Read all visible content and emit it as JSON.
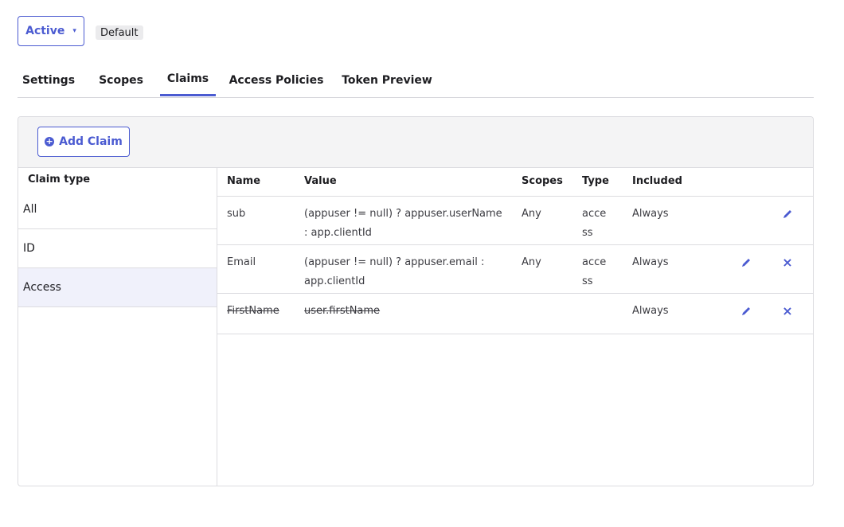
{
  "status": {
    "label": "Active",
    "caret": "▾"
  },
  "badge": {
    "label": "Default"
  },
  "tabs": [
    {
      "label": "Settings"
    },
    {
      "label": "Scopes"
    },
    {
      "label": "Claims"
    },
    {
      "label": "Access Policies"
    },
    {
      "label": "Token Preview"
    }
  ],
  "toolbar": {
    "add_claim_label": "Add Claim",
    "add_icon": "plus-circle-icon"
  },
  "claim_type": {
    "header": "Claim type",
    "items": [
      {
        "label": "All"
      },
      {
        "label": "ID"
      },
      {
        "label": "Access"
      }
    ],
    "selected": "Access"
  },
  "table": {
    "headers": {
      "name": "Name",
      "value": "Value",
      "scopes": "Scopes",
      "type": "Type",
      "included": "Included"
    },
    "rows": [
      {
        "name": "sub",
        "value_line1": "(appuser != null) ? appuser.userName",
        "value_line2": ": app.clientId",
        "scopes": "Any",
        "type_line1": "acce",
        "type_line2": "ss",
        "included": "Always"
      },
      {
        "name": "Email",
        "value_line1": "(appuser != null) ? appuser.email :",
        "value_line2": "app.clientId",
        "scopes": "Any",
        "type_line1": "acce",
        "type_line2": "ss",
        "included": "Always"
      },
      {
        "name": "FirstName",
        "value_line1": "user.firstName",
        "value_line2": "",
        "scopes": "",
        "type_line1": "",
        "type_line2": "",
        "included": "Always"
      }
    ]
  },
  "colors": {
    "accent": "#4b5bd1",
    "toolbar_bg": "#f4f4f5",
    "selected_bg": "#f0f1fb"
  },
  "icons": {
    "edit": "pencil-icon",
    "delete": "close-icon"
  }
}
